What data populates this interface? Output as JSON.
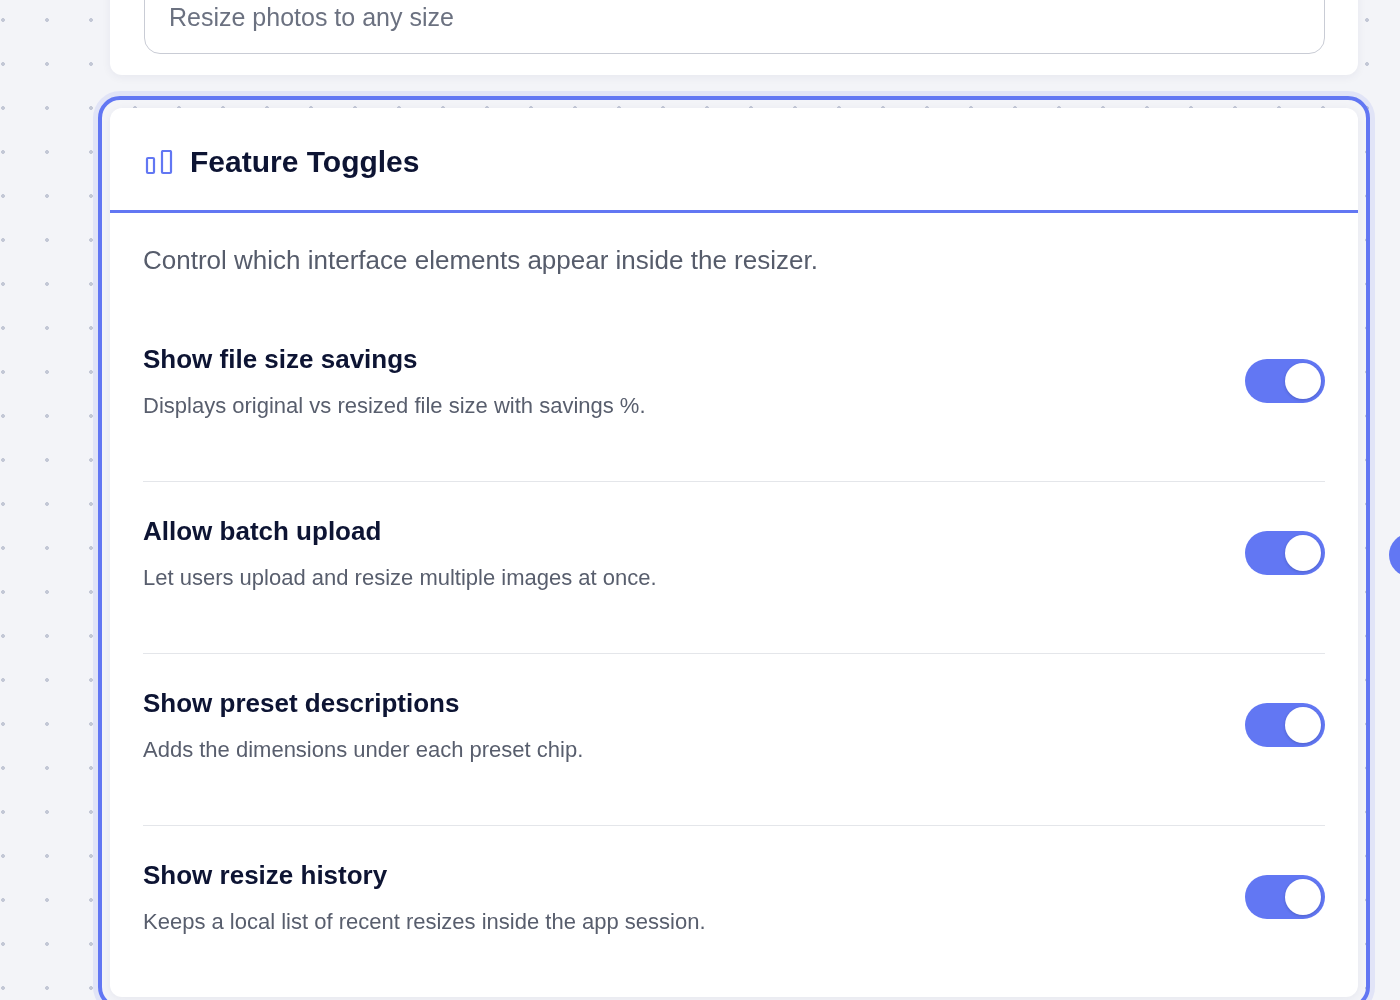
{
  "top_card": {
    "field": {
      "value": "Resize photos to any size"
    }
  },
  "feature_toggles": {
    "title": "Feature Toggles",
    "selected": true,
    "description": "Control which interface elements appear inside the resizer.",
    "toggles": [
      {
        "label": "Show file size savings",
        "description": "Displays original vs resized file size with savings %.",
        "on": true
      },
      {
        "label": "Allow batch upload",
        "description": "Let users upload and resize multiple images at once.",
        "on": true
      },
      {
        "label": "Show preset descriptions",
        "description": "Adds the dimensions under each preset chip.",
        "on": true
      },
      {
        "label": "Show resize history",
        "description": "Keeps a local list of recent resizes inside the app session.",
        "on": true
      }
    ]
  }
}
